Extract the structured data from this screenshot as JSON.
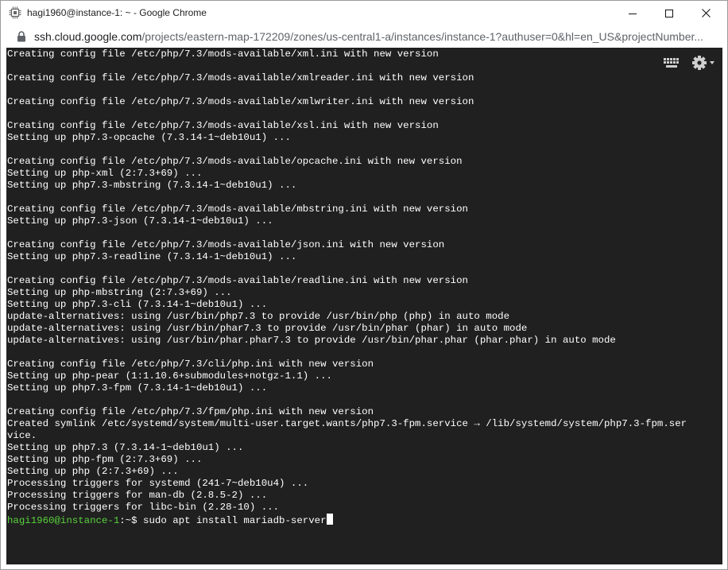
{
  "window": {
    "title": "hagi1960@instance-1: ~ - Google Chrome",
    "app_icon": "terminal-chip-icon",
    "controls": [
      "minimize-icon",
      "maximize-icon",
      "close-icon"
    ]
  },
  "addressbar": {
    "security_icon": "lock-icon",
    "host": "ssh.cloud.google.com",
    "path": "/projects/eastern-map-172209/zones/us-central1-a/instances/instance-1?authuser=0&hl=en_US&projectNumber..."
  },
  "terminal": {
    "toolbar": {
      "keyboard_icon": "keyboard-icon",
      "settings_icon": "gear-icon"
    },
    "lines": [
      "Creating config file /etc/php/7.3/mods-available/xml.ini with new version",
      "",
      "Creating config file /etc/php/7.3/mods-available/xmlreader.ini with new version",
      "",
      "Creating config file /etc/php/7.3/mods-available/xmlwriter.ini with new version",
      "",
      "Creating config file /etc/php/7.3/mods-available/xsl.ini with new version",
      "Setting up php7.3-opcache (7.3.14-1~deb10u1) ...",
      "",
      "Creating config file /etc/php/7.3/mods-available/opcache.ini with new version",
      "Setting up php-xml (2:7.3+69) ...",
      "Setting up php7.3-mbstring (7.3.14-1~deb10u1) ...",
      "",
      "Creating config file /etc/php/7.3/mods-available/mbstring.ini with new version",
      "Setting up php7.3-json (7.3.14-1~deb10u1) ...",
      "",
      "Creating config file /etc/php/7.3/mods-available/json.ini with new version",
      "Setting up php7.3-readline (7.3.14-1~deb10u1) ...",
      "",
      "Creating config file /etc/php/7.3/mods-available/readline.ini with new version",
      "Setting up php-mbstring (2:7.3+69) ...",
      "Setting up php7.3-cli (7.3.14-1~deb10u1) ...",
      "update-alternatives: using /usr/bin/php7.3 to provide /usr/bin/php (php) in auto mode",
      "update-alternatives: using /usr/bin/phar7.3 to provide /usr/bin/phar (phar) in auto mode",
      "update-alternatives: using /usr/bin/phar.phar7.3 to provide /usr/bin/phar.phar (phar.phar) in auto mode",
      "",
      "Creating config file /etc/php/7.3/cli/php.ini with new version",
      "Setting up php-pear (1:1.10.6+submodules+notgz-1.1) ...",
      "Setting up php7.3-fpm (7.3.14-1~deb10u1) ...",
      "",
      "Creating config file /etc/php/7.3/fpm/php.ini with new version",
      "Created symlink /etc/systemd/system/multi-user.target.wants/php7.3-fpm.service → /lib/systemd/system/php7.3-fpm.ser",
      "vice.",
      "Setting up php7.3 (7.3.14-1~deb10u1) ...",
      "Setting up php-fpm (2:7.3+69) ...",
      "Setting up php (2:7.3+69) ...",
      "Processing triggers for systemd (241-7~deb10u4) ...",
      "Processing triggers for man-db (2.8.5-2) ...",
      "Processing triggers for libc-bin (2.28-10) ..."
    ],
    "prompt": {
      "user_host": "hagi1960@instance-1",
      "path": ":~$ ",
      "command": "sudo apt install mariadb-server"
    }
  },
  "colors": {
    "terminal_bg": "#202020",
    "terminal_fg": "#ffffff",
    "prompt_green": "#58d33c"
  }
}
